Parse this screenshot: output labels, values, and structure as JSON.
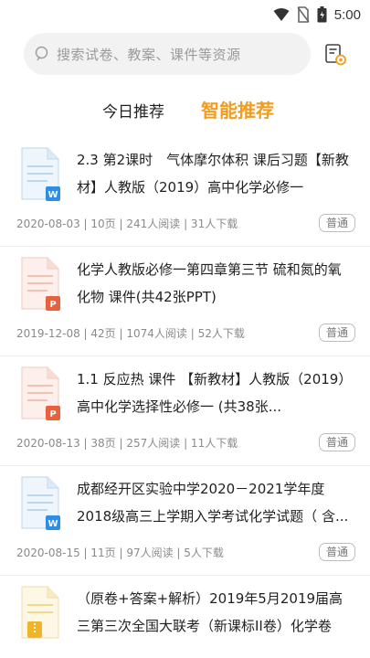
{
  "status_bar": {
    "time": "5:00"
  },
  "search": {
    "placeholder": "搜索试卷、教案、课件等资源"
  },
  "tabs": [
    {
      "label": "今日推荐",
      "active": false
    },
    {
      "label": "智能推荐",
      "active": true
    }
  ],
  "colors": {
    "accent": "#f29c1f",
    "word": "#2e8ee6",
    "ppt": "#e8603c",
    "zip": "#f0b429"
  },
  "items": [
    {
      "icon": "word-doc-icon",
      "title": "2.3 第2课时　气体摩尔体积 课后习题【新教材】人教版（2019）高中化学必修一",
      "meta": "2020-08-03 | 10页 | 241人阅读 | 31人下载",
      "badge": "普通"
    },
    {
      "icon": "ppt-doc-icon",
      "title": "化学人教版必修一第四章第三节 硫和氮的氧化物 课件(共42张PPT)",
      "meta": "2019-12-08 | 42页 | 1074人阅读 | 52人下载",
      "badge": "普通"
    },
    {
      "icon": "ppt-doc-icon",
      "title": "1.1 反应热 课件 【新教材】人教版（2019）高中化学选择性必修一 (共38张...",
      "meta": "2020-08-13 | 38页 | 257人阅读 | 11人下载",
      "badge": "普通"
    },
    {
      "icon": "word-doc-icon",
      "title": "成都经开区实验中学2020－2021学年度2018级高三上学期入学考试化学试题（ 含...",
      "meta": "2020-08-15 | 11页 | 97人阅读 | 5人下载",
      "badge": "普通"
    },
    {
      "icon": "zip-doc-icon",
      "title": "（原卷+答案+解析）2019年5月2019届高三第三次全国大联考（新课标II卷）化学卷",
      "meta": "",
      "badge": ""
    }
  ]
}
